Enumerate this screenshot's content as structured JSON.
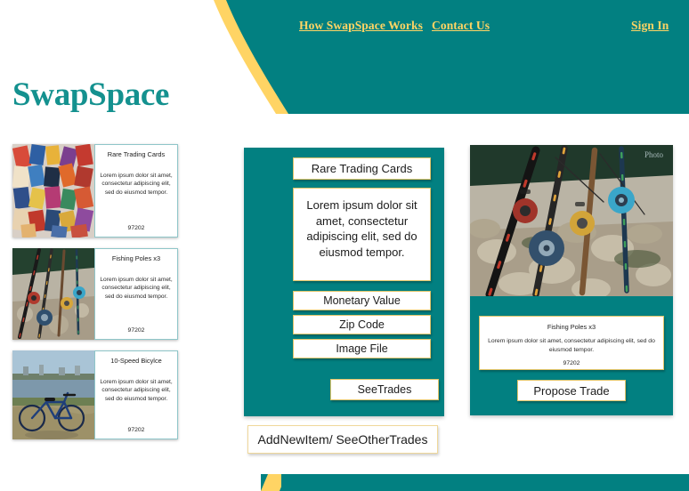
{
  "brand": {
    "name": "SwapSpace"
  },
  "nav": {
    "links": [
      {
        "label": "How SwapSpace Works",
        "name": "nav-link-how-it-works"
      },
      {
        "label": "Contact Us",
        "name": "nav-link-contact-us"
      },
      {
        "label": "Sign In",
        "name": "nav-link-sign-in"
      }
    ]
  },
  "colors": {
    "teal": "#028081",
    "brand_teal": "#14918f",
    "panel_teal": "#028081",
    "gold": "#ffd464",
    "field_border": "#e0c469",
    "card_border": "#8fc6c9",
    "white": "#ffffff"
  },
  "sidebar": {
    "listings": [
      {
        "title": "Rare Trading Cards",
        "description": "Lorem ipsum dolor sit amet, consectetur adipiscing elit, sed do eiusmod tempor.",
        "zip": "97202",
        "photo": "trading-cards-photo"
      },
      {
        "title": "Fishing Poles x3",
        "description": "Lorem ipsum dolor sit amet, consectetur adipiscing elit, sed do eiusmod tempor.",
        "zip": "97202",
        "photo": "fishing-poles-photo"
      },
      {
        "title": "10-Speed Bicylce",
        "description": "Lorem ipsum dolor sit amet, consectetur adipiscing elit, sed do eiusmod tempor.",
        "zip": "97202",
        "photo": "bicycle-photo"
      }
    ]
  },
  "center_panel": {
    "title_field": "Rare Trading Cards",
    "description_field": "Lorem ipsum dolor sit amet, consectetur adipiscing elit, sed do eiusmod tempor.",
    "monetary_value_field": "Monetary Value",
    "zip_code_field": "Zip Code",
    "image_file_field": "Image File",
    "see_trades_button": "SeeTrades"
  },
  "add_new_item_button": "AddNewItem/ SeeOtherTrades",
  "right_panel": {
    "photo": "fishing-poles-photo",
    "info_title": "Fishing Poles x3",
    "info_description": "Lorem ipsum dolor sit amet, consectetur adipiscing elit, sed do eiusmod tempor.",
    "info_zip": "97202",
    "propose_trade_button": "Propose Trade"
  }
}
